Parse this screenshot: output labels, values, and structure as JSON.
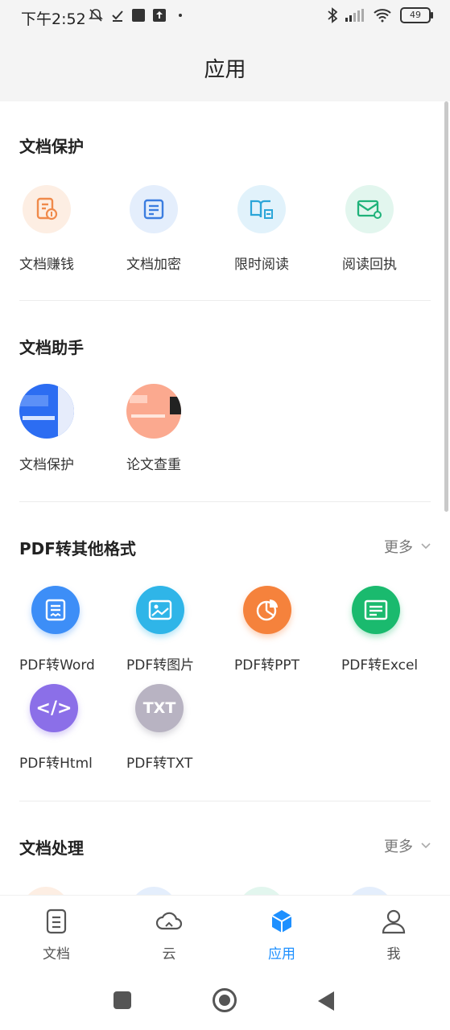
{
  "status_bar": {
    "time": "下午2:52",
    "battery": "49"
  },
  "header": {
    "title": "应用"
  },
  "sections": [
    {
      "title": "文档保护",
      "apps": [
        {
          "label": "文档赚钱",
          "icon": "doc-money-icon"
        },
        {
          "label": "文档加密",
          "icon": "doc-encrypt-icon"
        },
        {
          "label": "限时阅读",
          "icon": "timed-read-icon"
        },
        {
          "label": "阅读回执",
          "icon": "read-receipt-icon"
        }
      ]
    },
    {
      "title": "文档助手",
      "apps": [
        {
          "label": "文档保护",
          "icon": "doc-protect-thumbnail"
        },
        {
          "label": "论文查重",
          "icon": "thesis-check-thumbnail"
        }
      ]
    },
    {
      "title": "PDF转其他格式",
      "more": "更多",
      "apps": [
        {
          "label": "PDF转Word",
          "icon": "pdf-word-icon"
        },
        {
          "label": "PDF转图片",
          "icon": "pdf-image-icon"
        },
        {
          "label": "PDF转PPT",
          "icon": "pdf-ppt-icon"
        },
        {
          "label": "PDF转Excel",
          "icon": "pdf-excel-icon"
        },
        {
          "label": "PDF转Html",
          "icon": "pdf-html-icon",
          "glyph": "</>"
        },
        {
          "label": "PDF转TXT",
          "icon": "pdf-txt-icon",
          "glyph": "TXT"
        }
      ]
    },
    {
      "title": "文档处理",
      "more": "更多"
    }
  ],
  "tab_bar": {
    "tabs": [
      {
        "label": "文档",
        "icon": "document-icon"
      },
      {
        "label": "云",
        "icon": "cloud-icon"
      },
      {
        "label": "应用",
        "icon": "apps-cube-icon",
        "active": true
      },
      {
        "label": "我",
        "icon": "profile-icon"
      }
    ]
  },
  "colors": {
    "accent": "#1e90ff",
    "word": "#3d8ef7",
    "image": "#2fb5e8",
    "ppt": "#f5823c",
    "excel": "#1aba6e",
    "html": "#8b6fe8",
    "txt": "#b8b3c2"
  }
}
